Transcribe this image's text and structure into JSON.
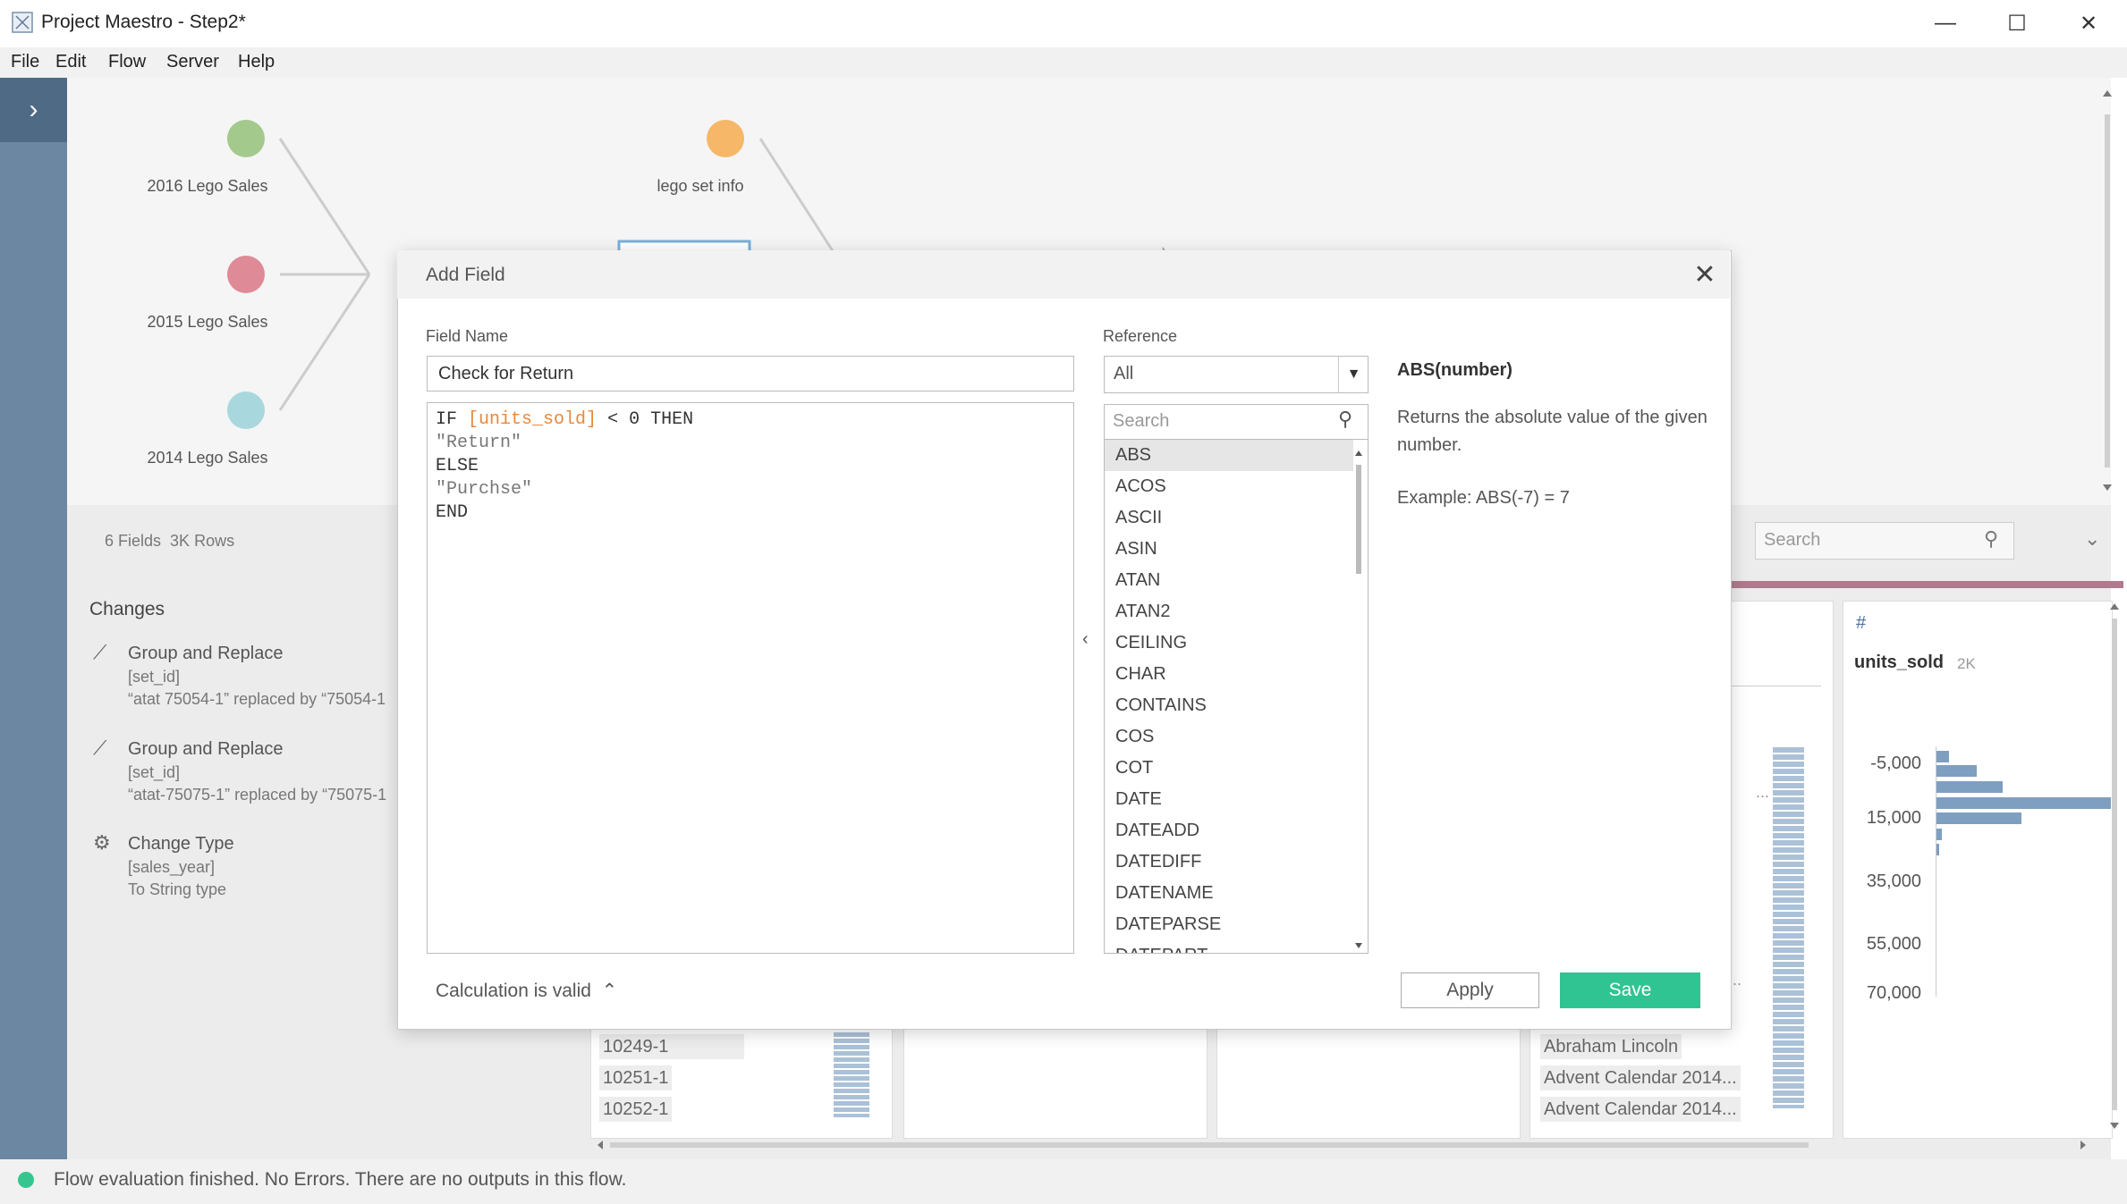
{
  "window": {
    "title": "Project Maestro - Step2*",
    "minimize_glyph": "—",
    "maximize_glyph": "☐",
    "close_glyph": "✕"
  },
  "menu": [
    "File",
    "Edit",
    "Flow",
    "Server",
    "Help"
  ],
  "flow": {
    "inputs": [
      {
        "label": "2016 Lego Sales",
        "color": "#a4c98c"
      },
      {
        "label": "2015 Lego Sales",
        "color": "#df8a97"
      },
      {
        "label": "2014 Lego Sales",
        "color": "#a9d7de"
      }
    ],
    "lookup": {
      "label": "lego set info",
      "color": "#f6b768"
    }
  },
  "profile": {
    "summary_fields": "6 Fields",
    "summary_rows": "3K Rows",
    "search_placeholder": "Search",
    "changes_title": "Changes",
    "changes": [
      {
        "title": "Group and Replace",
        "field": "[set_id]",
        "detail": "“atat 75054-1” replaced by “75054-1"
      },
      {
        "title": "Group and Replace",
        "field": "[set_id]",
        "detail": "“atat-75075-1” replaced by “75075-1"
      },
      {
        "title": "Change Type",
        "field": "[sales_year]",
        "detail": "To String type"
      }
    ],
    "units_card": {
      "type_icon": "#",
      "name": "units_sold",
      "count": "2K",
      "y_ticks": [
        "-5,000",
        "15,000",
        "35,000",
        "55,000",
        "70,000"
      ]
    },
    "set_id_values": [
      "10249-1",
      "10251-1",
      "10252-1"
    ],
    "set_name_values": [
      "Abraham Lincoln",
      "Advent Calendar 2014...",
      "Advent Calendar 2014..."
    ],
    "ellipsis": "..."
  },
  "dialog": {
    "title": "Add Field",
    "field_name_label": "Field Name",
    "field_name_value": "Check for Return",
    "formula": {
      "line1_kw": "IF",
      "line1_field": "[units_sold]",
      "line1_rest": "< 0 THEN",
      "line2": "\"Return\"",
      "line3": "ELSE",
      "line4": "\"Purchse\"",
      "line5": "END"
    },
    "reference_label": "Reference",
    "reference_value": "All",
    "search_placeholder": "Search",
    "functions": [
      "ABS",
      "ACOS",
      "ASCII",
      "ASIN",
      "ATAN",
      "ATAN2",
      "CEILING",
      "CHAR",
      "CONTAINS",
      "COS",
      "COT",
      "DATE",
      "DATEADD",
      "DATEDIFF",
      "DATENAME",
      "DATEPARSE",
      "DATEPART"
    ],
    "selected_function": "ABS",
    "help": {
      "signature": "ABS(number)",
      "description": "Returns the absolute value of the given number.",
      "example": "Example: ABS(-7) = 7"
    },
    "calc_status": "Calculation is valid",
    "apply_label": "Apply",
    "save_label": "Save"
  },
  "status": {
    "text": "Flow evaluation finished. No Errors. There are no outputs in this flow.",
    "color": "#36c58f"
  }
}
